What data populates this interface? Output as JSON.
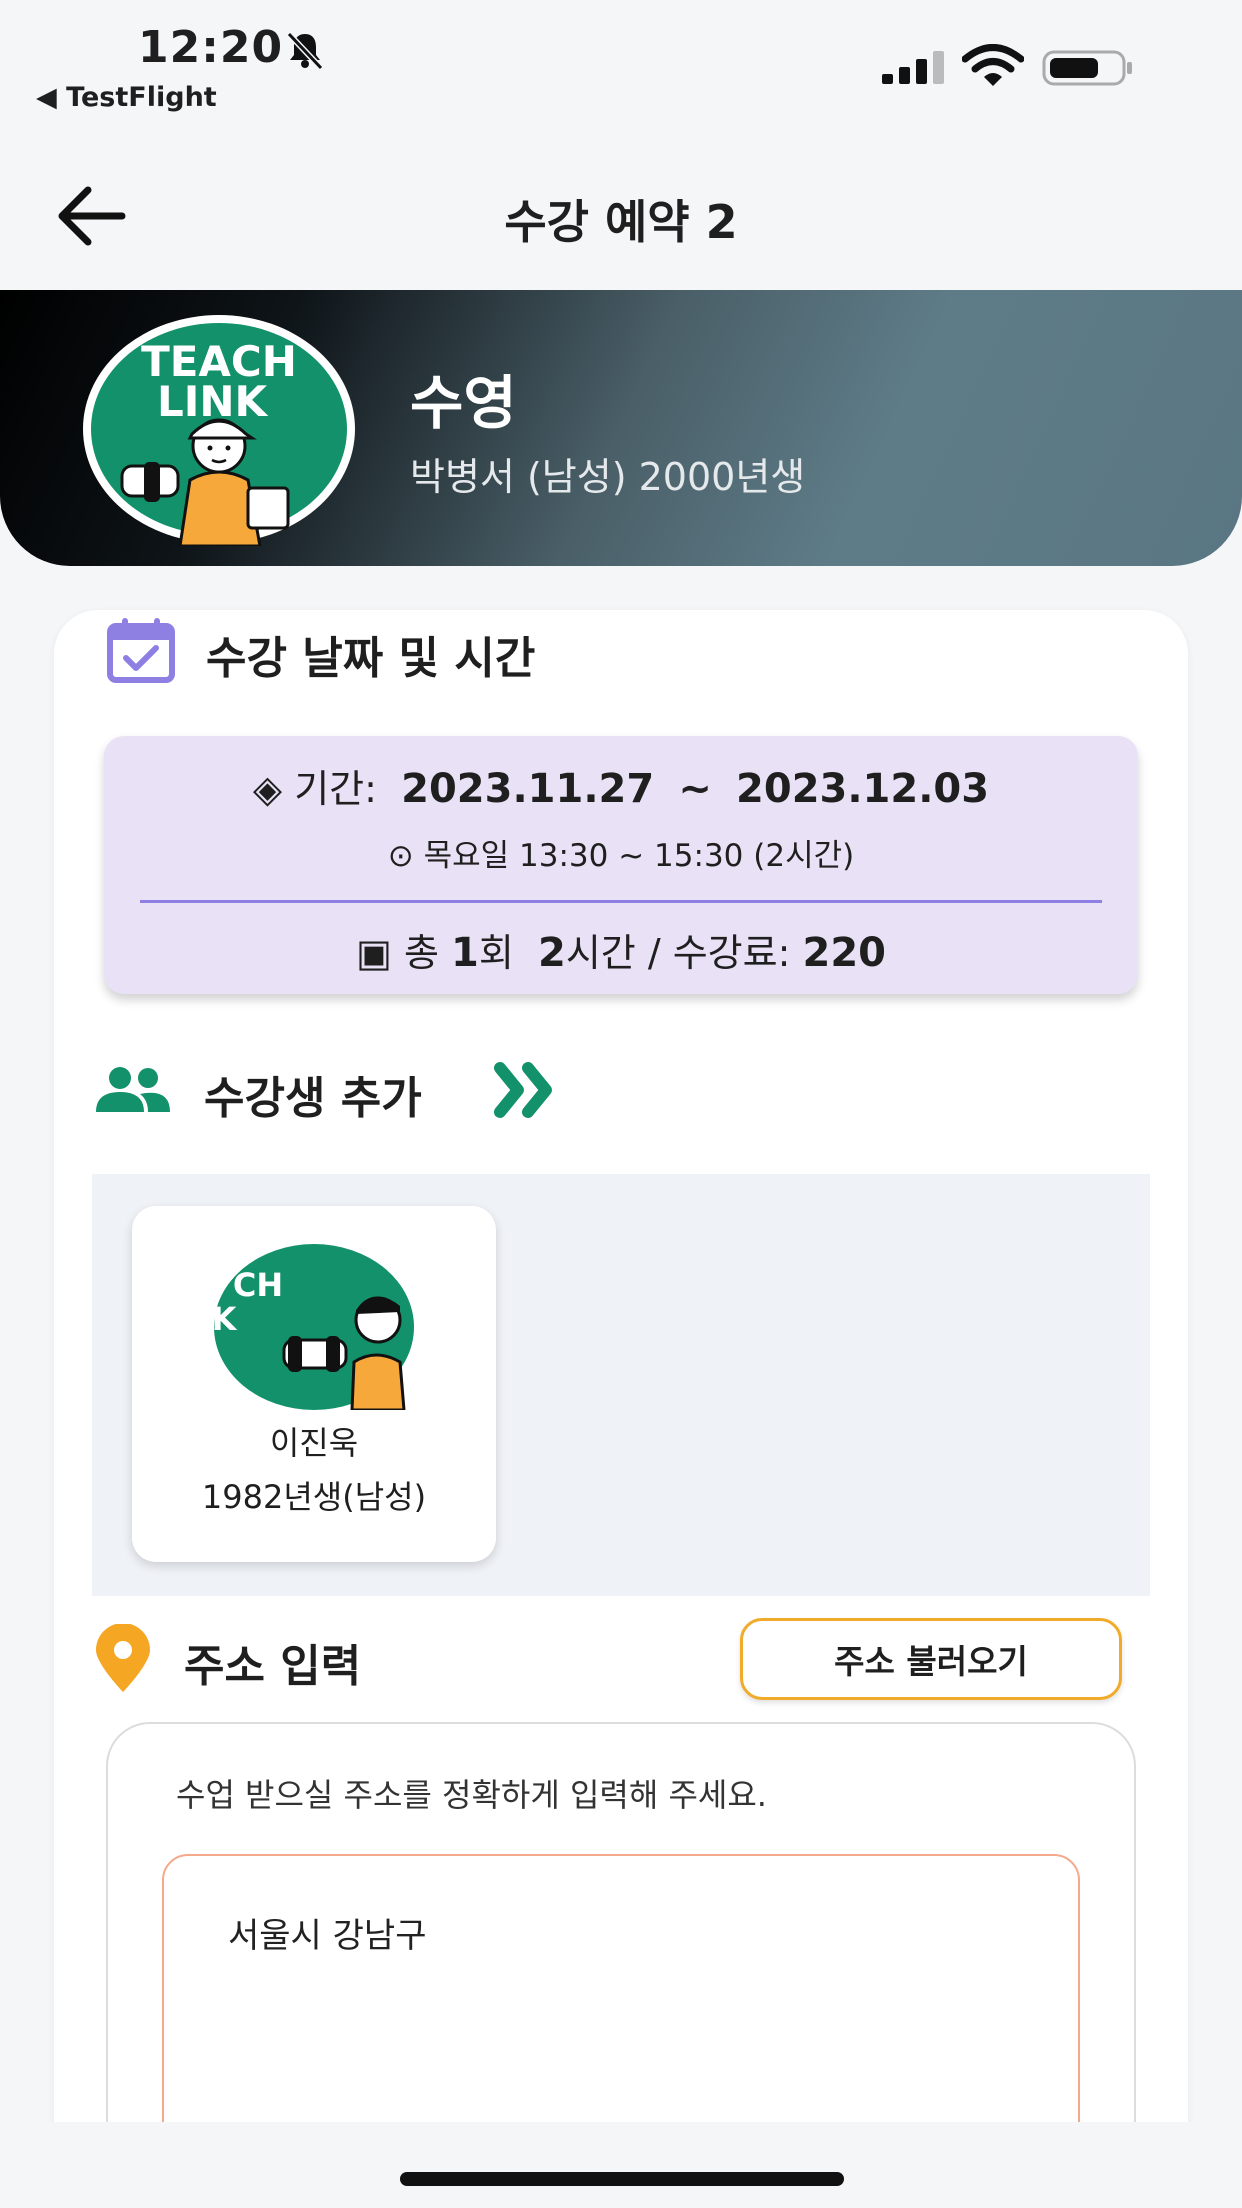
{
  "status_bar": {
    "time": "12:20",
    "back_app": "◀ TestFlight"
  },
  "header": {
    "title": "수강 예약 2"
  },
  "banner": {
    "avatar_text_line1": "TEACH",
    "avatar_text_line2": "LINK",
    "name": "수영",
    "subtitle": "박병서 (남성) 2000년생",
    "colors": {
      "logo_green": "#12916b",
      "shirt": "#f6a83a"
    }
  },
  "schedule_section": {
    "title": "수강 날짜 및 시간",
    "period_label": "◈ 기간:",
    "start_date": "2023.11.27",
    "tilde": "~",
    "end_date": "2023.12.03",
    "weekday_time": "⊙ 목요일 13:30 ~ 15:30 (2시간)",
    "total_prefix": "▣ 총",
    "total_count": "1",
    "total_count_unit": "회",
    "total_hours": "2",
    "total_hours_unit": "시간 / 수강료:",
    "fee": "220",
    "colors": {
      "box": "#e9e2f6",
      "divider": "#8e7fe3",
      "icon": "#8e7fe3"
    }
  },
  "student_section": {
    "title": "수강생 추가",
    "icon": "people-icon",
    "action_icon": "double-chevron-right-icon",
    "students": [
      {
        "avatar_text_line1": "CH",
        "avatar_text_line2": "K",
        "name": "이진욱",
        "info": "1982년생(남성)"
      }
    ],
    "colors": {
      "accent": "#12916b"
    }
  },
  "address_section": {
    "title": "주소 입력",
    "load_button": "주소 불러오기",
    "guide": "수업 받으실 주소를 정확하게 입력해 주세요.",
    "address_value": "서울시 강남구",
    "colors": {
      "pin": "#f5a623",
      "button_border": "#f1ab2a",
      "input_border": "#f3a98a"
    }
  }
}
